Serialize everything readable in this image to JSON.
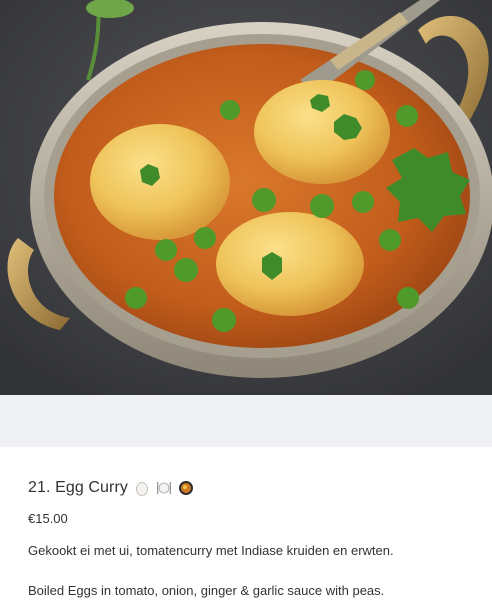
{
  "item": {
    "title": "21. Egg Curry",
    "emoji_icons": [
      "egg-icon",
      "plate-cutlery-icon",
      "curry-bowl-icon"
    ],
    "price": "€15.00",
    "description_nl": "Gekookt ei met ui, tomatencurry met Indiase kruiden en erwten.",
    "description_en": "Boiled Eggs in tomato, onion, ginger & garlic sauce with peas."
  },
  "colors": {
    "band": "#eff1f4",
    "text": "#333333",
    "photo_bg": "#3e3f42",
    "curry": "#c8611f",
    "pea": "#4f9a2a",
    "egg": "#f3cb63",
    "copper": "#b5894a"
  }
}
